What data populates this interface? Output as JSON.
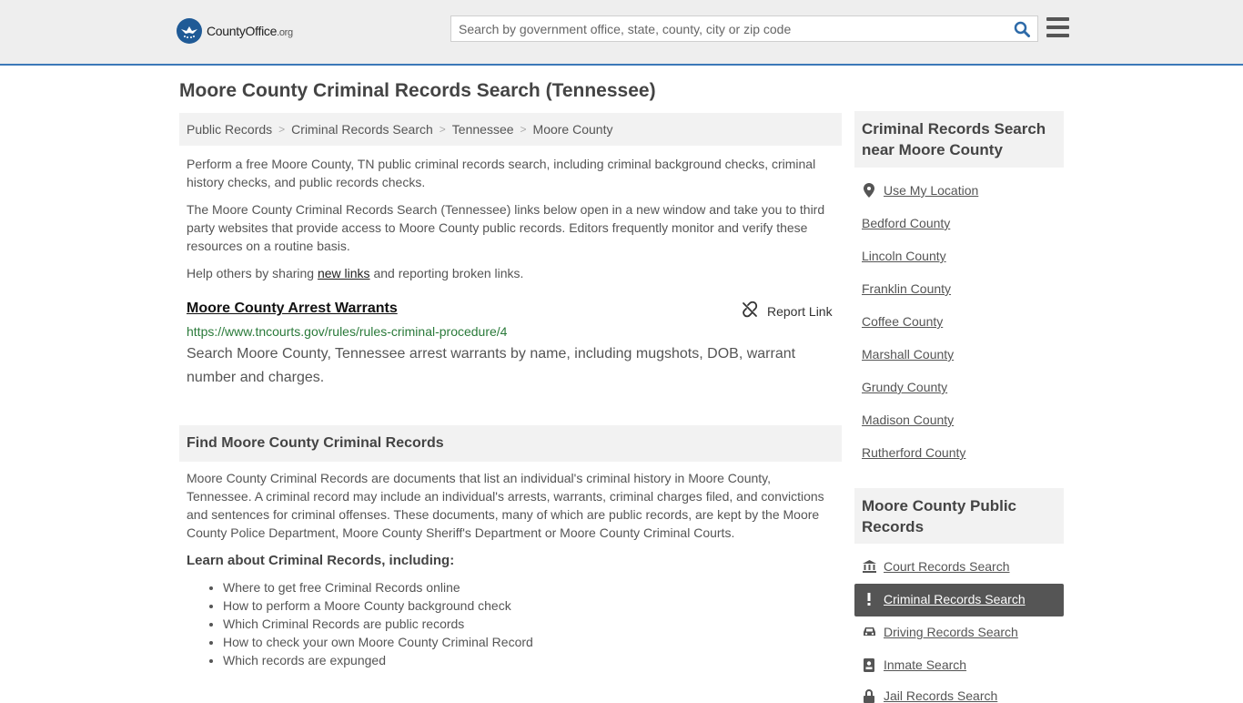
{
  "header": {
    "logo_text": "CountyOffice",
    "logo_suffix": ".org",
    "search_placeholder": "Search by government office, state, county, city or zip code"
  },
  "page_title": "Moore County Criminal Records Search (Tennessee)",
  "breadcrumb": [
    "Public Records",
    "Criminal Records Search",
    "Tennessee",
    "Moore County"
  ],
  "intro": {
    "p1": "Perform a free Moore County, TN public criminal records search, including criminal background checks, criminal history checks, and public records checks.",
    "p2": "The Moore County Criminal Records Search (Tennessee) links below open in a new window and take you to third party websites that provide access to Moore County public records. Editors frequently monitor and verify these resources on a routine basis.",
    "p3_before": "Help others by sharing ",
    "p3_link": "new links",
    "p3_after": " and reporting broken links."
  },
  "result": {
    "title": "Moore County Arrest Warrants",
    "report_label": "Report Link",
    "url": "https://www.tncourts.gov/rules/rules-criminal-procedure/4",
    "description": "Search Moore County, Tennessee arrest warrants by name, including mugshots, DOB, warrant number and charges."
  },
  "find_section": {
    "heading": "Find Moore County Criminal Records",
    "body": "Moore County Criminal Records are documents that list an individual's criminal history in Moore County, Tennessee. A criminal record may include an individual's arrests, warrants, criminal charges filed, and convictions and sentences for criminal offenses. These documents, many of which are public records, are kept by the Moore County Police Department, Moore County Sheriff's Department or Moore County Criminal Courts.",
    "learn_heading": "Learn about Criminal Records, including:",
    "learn_items": [
      "Where to get free Criminal Records online",
      "How to perform a Moore County background check",
      "Which Criminal Records are public records",
      "How to check your own Moore County Criminal Record",
      "Which records are expunged"
    ]
  },
  "sidebar": {
    "nearby_heading": "Criminal Records Search near Moore County",
    "use_location": "Use My Location",
    "nearby": [
      "Bedford County",
      "Lincoln County",
      "Franklin County",
      "Coffee County",
      "Marshall County",
      "Grundy County",
      "Madison County",
      "Rutherford County"
    ],
    "public_heading": "Moore County Public Records",
    "public_links": [
      {
        "label": "Court Records Search",
        "icon": "courthouse-icon"
      },
      {
        "label": "Criminal Records Search",
        "icon": "exclamation-icon"
      },
      {
        "label": "Driving Records Search",
        "icon": "car-icon"
      },
      {
        "label": "Inmate Search",
        "icon": "id-badge-icon"
      },
      {
        "label": "Jail Records Search",
        "icon": "lock-icon"
      }
    ]
  },
  "colors": {
    "header_bg": "#eeeeee",
    "header_border": "#3b78b8",
    "url_green": "#2a7a3a",
    "active_bg": "#555555"
  }
}
